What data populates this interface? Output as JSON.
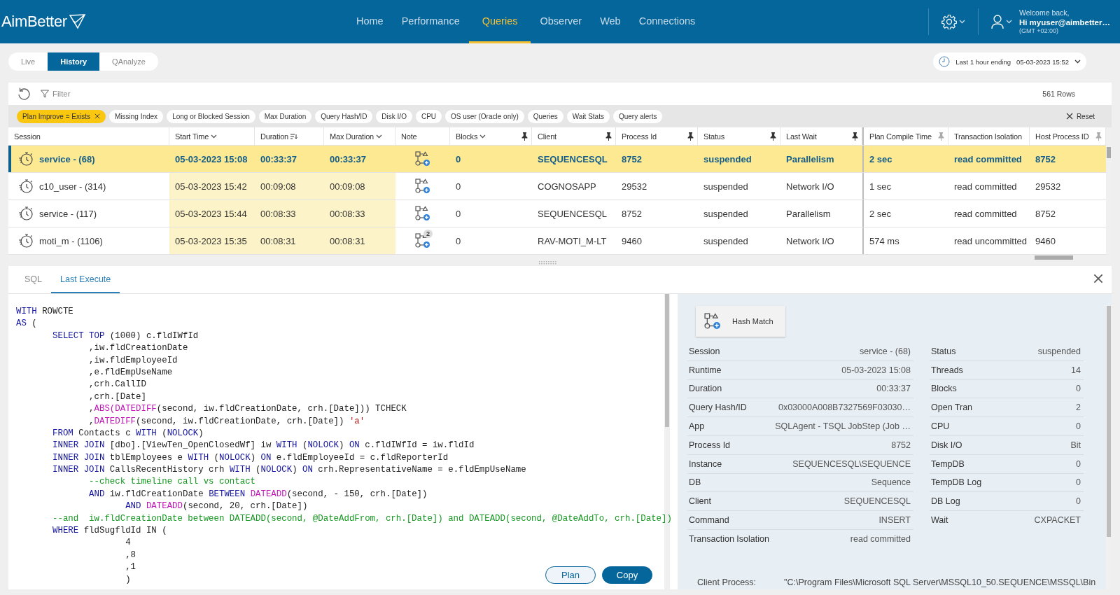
{
  "header": {
    "logo": "AimBetter",
    "nav": [
      {
        "label": "Home",
        "selected": false
      },
      {
        "label": "Performance",
        "selected": false
      },
      {
        "label": "Queries",
        "selected": true
      },
      {
        "label": "Observer",
        "selected": false
      },
      {
        "label": "Web",
        "selected": false
      },
      {
        "label": "Connections",
        "selected": false
      }
    ],
    "welcome": "Welcome back,",
    "user": "Hi myuser@aimbetter…",
    "timezone": "(GMT +02:00)"
  },
  "modes": [
    {
      "label": "Live",
      "selected": false
    },
    {
      "label": "History",
      "selected": true
    },
    {
      "label": "QAnalyze",
      "selected": false
    }
  ],
  "time_range": {
    "label": "Last 1 hour ending",
    "value": "05-03-2023 15:52"
  },
  "toolbar": {
    "filter": "Filter",
    "row_count": "561 Rows"
  },
  "filter_chips": [
    {
      "label": "Plan Improve = Exists",
      "active": true
    },
    {
      "label": "Missing Index",
      "active": false
    },
    {
      "label": "Long or Blocked Session",
      "active": false
    },
    {
      "label": "Max Duration",
      "active": false
    },
    {
      "label": "Query Hash/ID",
      "active": false
    },
    {
      "label": "Disk I/O",
      "active": false
    },
    {
      "label": "CPU",
      "active": false
    },
    {
      "label": "OS user (Oracle only)",
      "active": false
    },
    {
      "label": "Queries",
      "active": false
    },
    {
      "label": "Wait Stats",
      "active": false
    },
    {
      "label": "Query alerts",
      "active": false
    }
  ],
  "reset": "Reset",
  "table": {
    "columns": [
      {
        "label": "Session",
        "kind": "session"
      },
      {
        "label": "Start Time",
        "kind": "text",
        "sort_menu": true,
        "highlighted": true
      },
      {
        "label": "Duration",
        "kind": "text",
        "sort_order": true,
        "highlighted": true
      },
      {
        "label": "Max Duration",
        "kind": "text",
        "sort_menu": true,
        "highlighted": true
      },
      {
        "label": "Note",
        "kind": "note"
      },
      {
        "label": "Blocks",
        "kind": "text",
        "sort_menu": true,
        "pinned": true
      },
      {
        "label": "Client",
        "kind": "text",
        "pinned": true
      },
      {
        "label": "Process Id",
        "kind": "text",
        "pinned": true
      },
      {
        "label": "Status",
        "kind": "text",
        "pinned": true
      },
      {
        "label": "Last Wait",
        "kind": "text",
        "pinned": true
      },
      {
        "label": "Plan Compile Time",
        "kind": "text",
        "pinned": false
      },
      {
        "label": "Transaction Isolation",
        "kind": "text"
      },
      {
        "label": "Host Process ID",
        "kind": "text",
        "pinned": false
      }
    ],
    "rows": [
      {
        "selected": true,
        "cells": [
          "service - (68)",
          "05-03-2023 15:08",
          "00:33:37",
          "00:33:37",
          null,
          "0",
          "SEQUENCESQL",
          "8752",
          "suspended",
          "Parallelism",
          "2 sec",
          "read committed",
          "8752"
        ]
      },
      {
        "selected": false,
        "cells": [
          "c10_user - (314)",
          "05-03-2023 15:42",
          "00:09:08",
          "00:09:08",
          null,
          "0",
          "COGNOSAPP",
          "29532",
          "suspended",
          "Network I/O",
          "1 sec",
          "read committed",
          "29532"
        ]
      },
      {
        "selected": false,
        "cells": [
          "service - (117)",
          "05-03-2023 15:44",
          "00:08:33",
          "00:08:33",
          null,
          "0",
          "SEQUENCESQL",
          "8752",
          "suspended",
          "Parallelism",
          "2 sec",
          "read committed",
          "8752"
        ]
      },
      {
        "selected": false,
        "cells": [
          "moti_m - (1106)",
          "05-03-2023 15:35",
          "00:08:31",
          "00:08:31",
          "2",
          "0",
          "RAV-MOTI_M-LT",
          "9460",
          "suspended",
          "Network I/O",
          "574 ms",
          "read uncommitted",
          "9460"
        ]
      }
    ]
  },
  "bottom_tabs": [
    {
      "label": "SQL",
      "selected": false
    },
    {
      "label": "Last Execute",
      "selected": true
    }
  ],
  "code": [
    [
      {
        "kind": "keyword",
        "text": "WITH"
      },
      " ROWCTE"
    ],
    [
      {
        "kind": "keyword",
        "text": "AS"
      },
      " ("
    ],
    [
      {
        "kind": "keyword",
        "text": "       SELECT TOP"
      },
      " (1000) c.fldIWfId"
    ],
    [
      "              ,iw.fldCreationDate"
    ],
    [
      "              ,iw.fldEmployeeId"
    ],
    [
      "              ,e.fldEmpUseName"
    ],
    [
      "              ,crh.CallID"
    ],
    [
      "              ,crh.[Date]"
    ],
    [
      "              ,",
      {
        "kind": "function",
        "text": "ABS(DATEDIFF"
      },
      "(second, iw.fldCreationDate, crh.[Date])) TCHECK"
    ],
    [
      "              ,",
      {
        "kind": "function",
        "text": "DATEDIFF"
      },
      "(second, iw.fldCreationDate, crh.[Date]) ",
      {
        "kind": "string",
        "text": "'a'"
      }
    ],
    [
      {
        "kind": "keyword",
        "text": "       FROM"
      },
      " Contacts c ",
      {
        "kind": "keyword",
        "text": "WITH"
      },
      " (",
      {
        "kind": "keyword",
        "text": "NOLOCK"
      },
      ")"
    ],
    [
      {
        "kind": "keyword",
        "text": "       INNER JOIN"
      },
      " [dbo].[ViewTen_OpenClosedWf] iw ",
      {
        "kind": "keyword",
        "text": "WITH"
      },
      " (",
      {
        "kind": "keyword",
        "text": "NOLOCK"
      },
      ") ",
      {
        "kind": "keyword",
        "text": "ON"
      },
      " c.fldIWfId = iw.fldId"
    ],
    [
      {
        "kind": "keyword",
        "text": "       INNER JOIN"
      },
      " tblEmployees e ",
      {
        "kind": "keyword",
        "text": "WITH"
      },
      " (",
      {
        "kind": "keyword",
        "text": "NOLOCK"
      },
      ") ",
      {
        "kind": "keyword",
        "text": "ON"
      },
      " e.fldEmployeeId = c.fldReporterId"
    ],
    [
      {
        "kind": "keyword",
        "text": "       INNER JOIN"
      },
      " CallsRecentHistory crh ",
      {
        "kind": "keyword",
        "text": "WITH"
      },
      " (",
      {
        "kind": "keyword",
        "text": "NOLOCK"
      },
      ") ",
      {
        "kind": "keyword",
        "text": "ON"
      },
      " crh.RepresentativeName = e.fldEmpUseName"
    ],
    [
      {
        "kind": "comment",
        "text": "              --check timeline call vs contact"
      }
    ],
    [
      {
        "kind": "keyword",
        "text": "              AND"
      },
      " iw.fldCreationDate ",
      {
        "kind": "keyword",
        "text": "BETWEEN "
      },
      {
        "kind": "function",
        "text": "DATEADD"
      },
      "(second, - 150, crh.[Date])"
    ],
    [
      {
        "kind": "keyword",
        "text": "                     AND "
      },
      {
        "kind": "function",
        "text": "DATEADD"
      },
      "(second, 20, crh.[Date])"
    ],
    [
      {
        "kind": "comment",
        "text": "       --and  iw.fldCreationDate between DATEADD(second, @DateAddFrom, crh.[Date]) and DATEADD(second, @DateAddTo, crh.[Date])"
      }
    ],
    [
      {
        "kind": "keyword",
        "text": "       WHERE"
      },
      " fldSugfldId IN ("
    ],
    [
      "                     4"
    ],
    [
      "                     ,8"
    ],
    [
      "                     ,1"
    ],
    [
      "                     )"
    ]
  ],
  "code_buttons": [
    {
      "label": "Plan",
      "kind": "secondary"
    },
    {
      "label": "Copy",
      "kind": "primary"
    }
  ],
  "details": {
    "operator": "Hash Match",
    "left": [
      {
        "label": "Session",
        "value": "service - (68)"
      },
      {
        "label": "Runtime",
        "value": "05-03-2023 15:08"
      },
      {
        "label": "Duration",
        "value": "00:33:37"
      },
      {
        "label": "Query Hash/ID",
        "value": "0x03000A008B7327569F03030…"
      },
      {
        "label": "App",
        "value": "SQLAgent - TSQL JobStep (Job …"
      },
      {
        "label": "Process Id",
        "value": "8752"
      },
      {
        "label": "Instance",
        "value": "SEQUENCESQL\\SEQUENCE"
      },
      {
        "label": "DB",
        "value": "Sequence"
      },
      {
        "label": "Client",
        "value": "SEQUENCESQL"
      },
      {
        "label": "Command",
        "value": "INSERT"
      },
      {
        "label": "Transaction Isolation",
        "value": "read committed"
      }
    ],
    "right": [
      {
        "label": "Status",
        "value": "suspended"
      },
      {
        "label": "Threads",
        "value": "14"
      },
      {
        "label": "Blocks",
        "value": "0"
      },
      {
        "label": "Open Tran",
        "value": "2"
      },
      {
        "label": "CPU",
        "value": "0"
      },
      {
        "label": "Disk I/O",
        "value": "Bit"
      },
      {
        "label": "TempDB",
        "value": "0"
      },
      {
        "label": "TempDB Log",
        "value": "0"
      },
      {
        "label": "DB Log",
        "value": "0"
      },
      {
        "label": "Wait",
        "value": "CXPACKET"
      }
    ],
    "client_process": {
      "label": "Client Process:",
      "value": "\"C:\\Program Files\\Microsoft SQL Server\\MSSQL10_50.SEQUENCE\\MSSQL\\Bin"
    }
  }
}
